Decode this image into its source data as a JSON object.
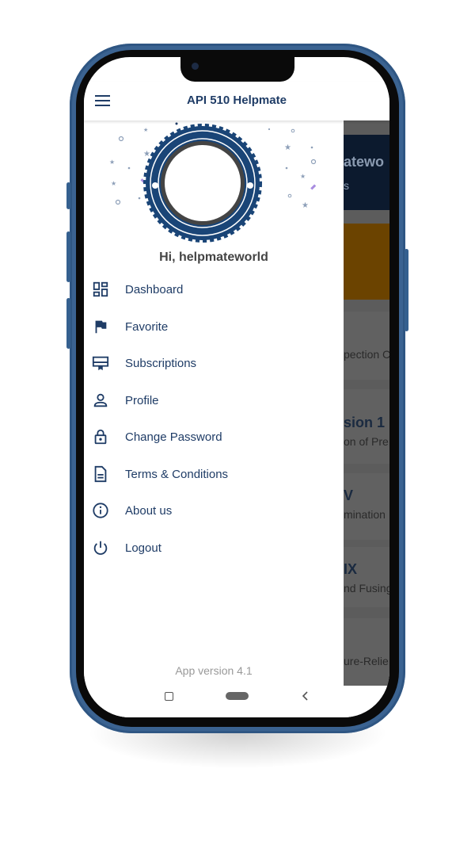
{
  "header": {
    "title": "API 510 Helpmate",
    "menu_icon": "hamburger-icon"
  },
  "user": {
    "greeting": "Hi, helpmateworld"
  },
  "menu": [
    {
      "label": "Dashboard",
      "icon": "dashboard-icon"
    },
    {
      "label": "Favorite",
      "icon": "flag-icon"
    },
    {
      "label": "Subscriptions",
      "icon": "subscriptions-icon"
    },
    {
      "label": "Profile",
      "icon": "person-icon"
    },
    {
      "label": "Change Password",
      "icon": "lock-icon"
    },
    {
      "label": "Terms & Conditions",
      "icon": "document-icon"
    },
    {
      "label": "About us",
      "icon": "info-icon"
    },
    {
      "label": "Logout",
      "icon": "power-icon"
    }
  ],
  "app_version": "App version 4.1",
  "background": {
    "cards": [
      {
        "a": "atewo",
        "b": "s"
      },
      {
        "a": "",
        "b": ""
      },
      {
        "a": "",
        "b": "pection C"
      },
      {
        "a": "sion 1",
        "b": "on of Pre"
      },
      {
        "a": "V",
        "b": "mination"
      },
      {
        "a": "IX",
        "b": "nd Fusing"
      },
      {
        "a": "",
        "b": "ure-Relie"
      }
    ]
  },
  "colors": {
    "primary": "#1f3c66",
    "phone": "#3b6391",
    "accent_orange": "#6b4300"
  }
}
